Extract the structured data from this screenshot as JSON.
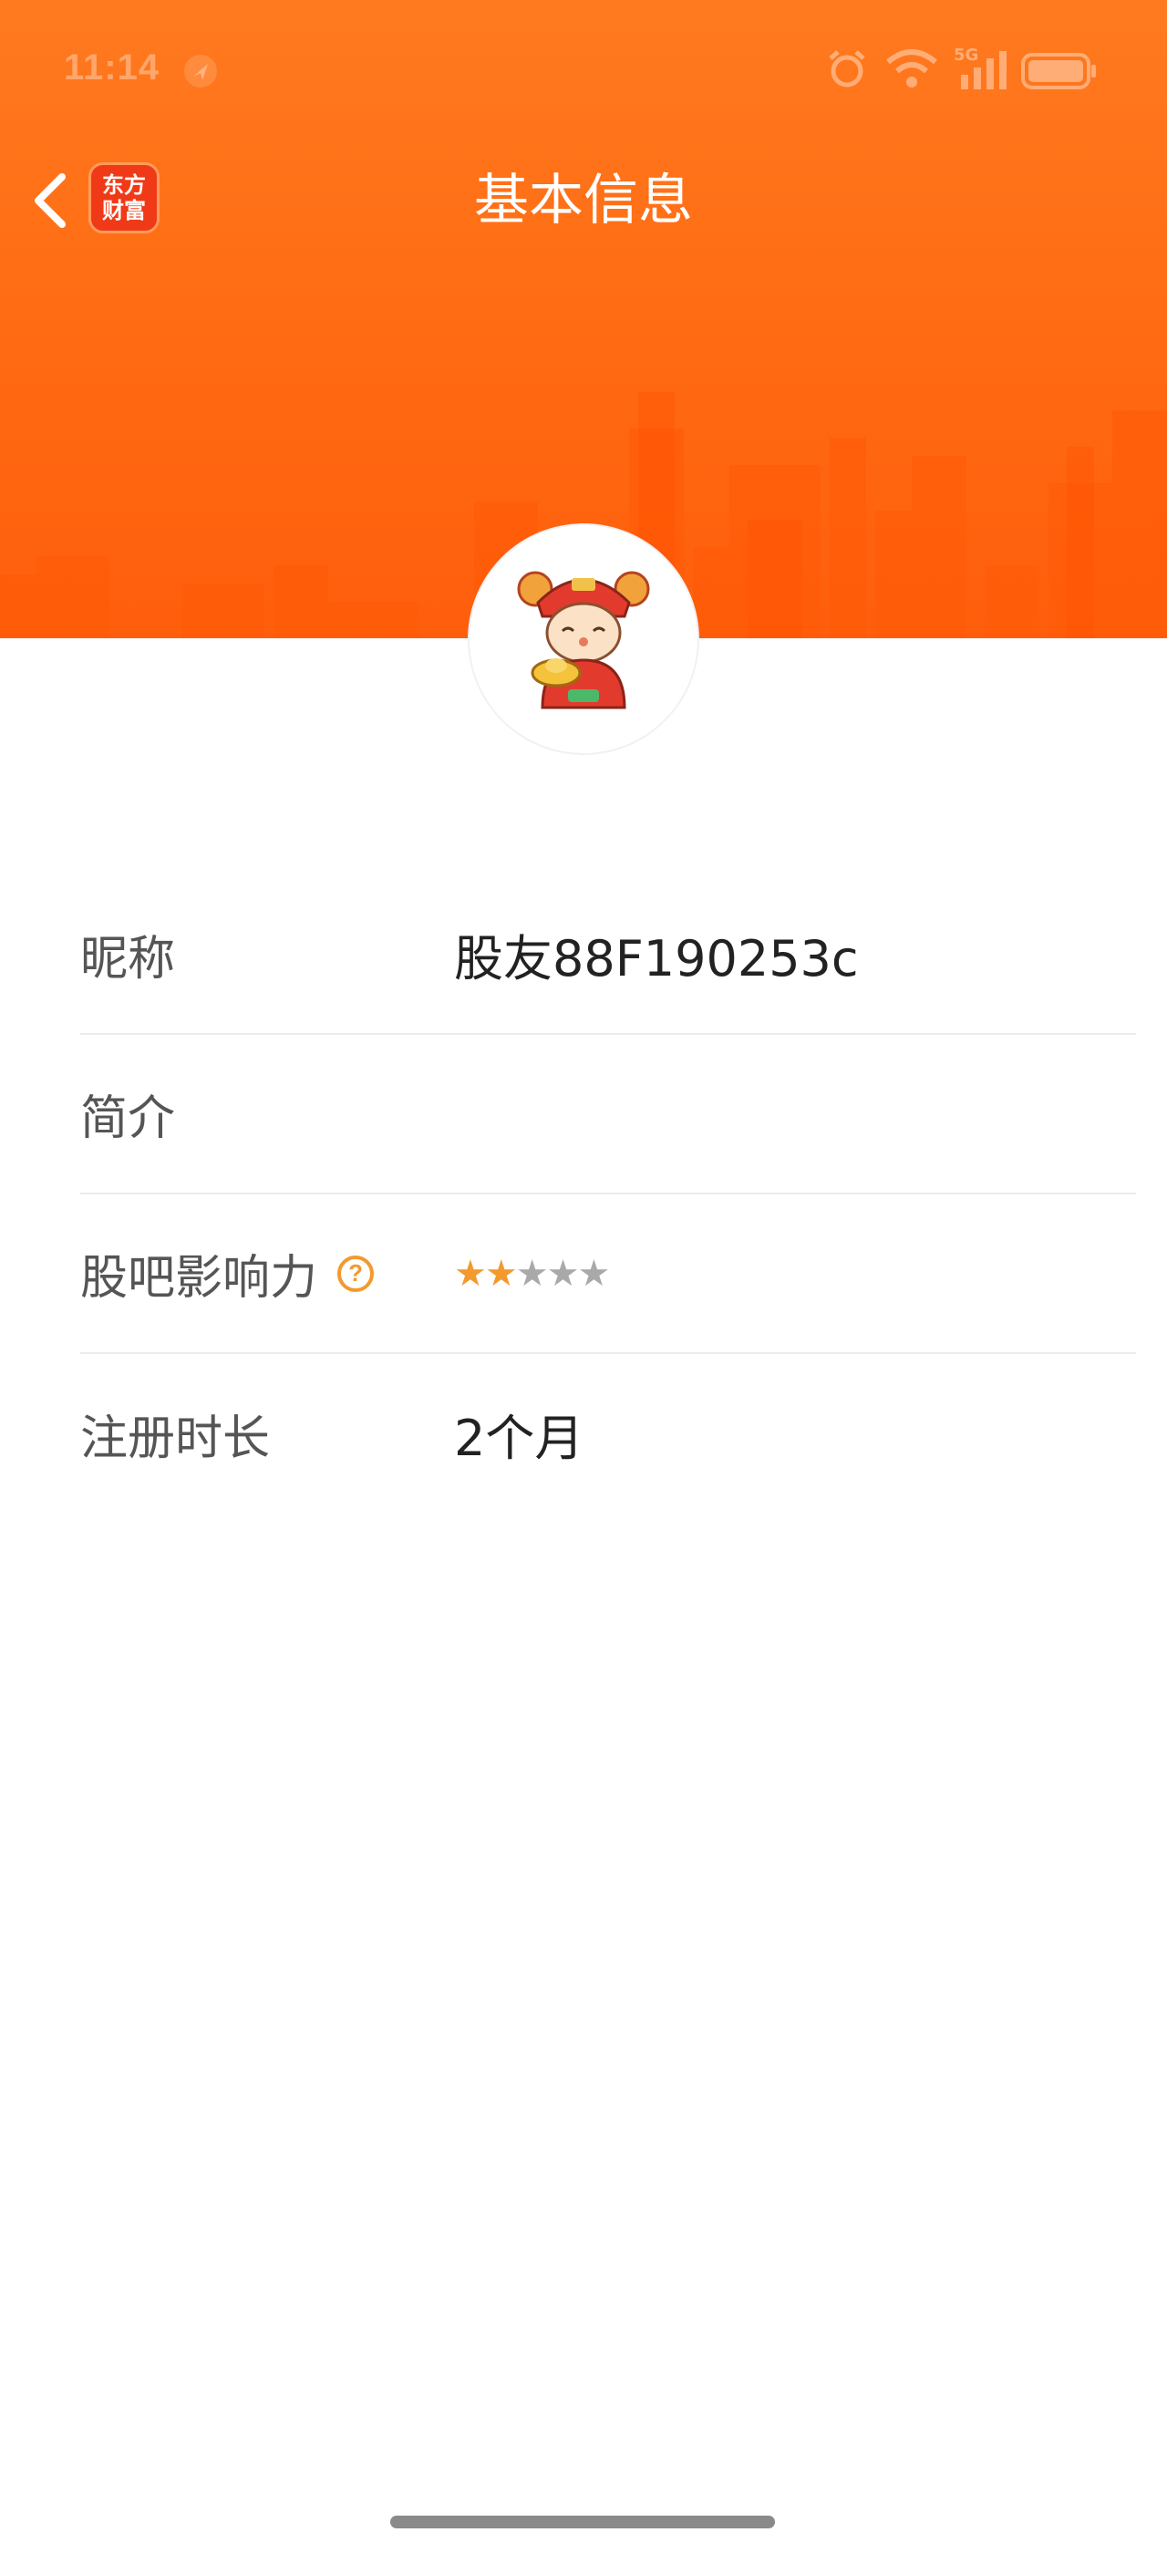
{
  "status_bar": {
    "time": "11:14",
    "network_label": "5G"
  },
  "header": {
    "title": "基本信息",
    "logo_line1": "东方",
    "logo_line2": "财富"
  },
  "profile": {
    "rows": [
      {
        "label": "昵称",
        "value": "股友88F190253c"
      },
      {
        "label": "简介",
        "value": ""
      },
      {
        "label": "股吧影响力",
        "help_icon": "?",
        "rating": 2,
        "rating_max": 5
      },
      {
        "label": "注册时长",
        "value": "2个月"
      }
    ]
  },
  "colors": {
    "banner": "#ff6a12",
    "star_active": "#f29a2e",
    "star_inactive": "#a9a9a9"
  },
  "icons": {
    "back": "chevron-left-icon",
    "alarm": "alarm-icon",
    "wifi": "wifi-icon",
    "signal": "signal-icon",
    "battery": "battery-icon",
    "help": "question-circle-icon"
  }
}
